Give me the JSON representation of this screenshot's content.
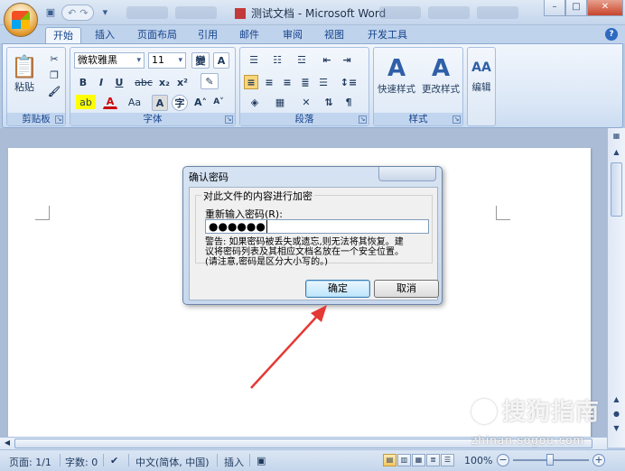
{
  "window": {
    "title": "测试文档 - Microsoft Word"
  },
  "tabs": [
    "开始",
    "插入",
    "页面布局",
    "引用",
    "邮件",
    "审阅",
    "视图",
    "开发工具"
  ],
  "ribbon": {
    "clipboard": {
      "label": "剪贴板",
      "paste": "粘贴"
    },
    "font": {
      "label": "字体",
      "font_name": "微软雅黑",
      "font_size": "11"
    },
    "paragraph": {
      "label": "段落"
    },
    "styles": {
      "label": "样式",
      "quick_styles": "快速样式",
      "change_styles": "更改样式"
    },
    "editing": {
      "label": "编辑"
    }
  },
  "dialog": {
    "title": "确认密码",
    "group_label": "对此文件的内容进行加密",
    "password_label": "重新输入密码(R):",
    "password_value": "●●●●●●",
    "warning_line1": "警告: 如果密码被丢失或遗忘,则无法将其恢复。建",
    "warning_line2": "议将密码列表及其相应文档名放在一个安全位置。",
    "warning_line3": "(请注意,密码是区分大小写的。)",
    "ok": "确定",
    "cancel": "取消"
  },
  "statusbar": {
    "page": "页面: 1/1",
    "words": "字数: 0",
    "language": "中文(简体, 中国)",
    "insert_mode": "插入",
    "zoom": "100%"
  },
  "watermark": {
    "text": "搜狗指南",
    "url": "zhinan.sogou.com"
  }
}
